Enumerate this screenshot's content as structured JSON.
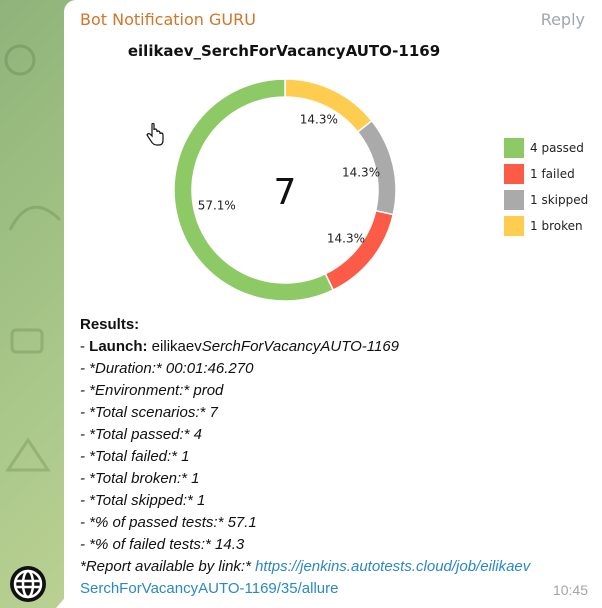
{
  "message": {
    "sender": "Bot Notification GURU",
    "reply_label": "Reply",
    "time": "10:45"
  },
  "colors": {
    "passed": "#8dc965",
    "failed": "#fc5b48",
    "skipped": "#aaaaaa",
    "broken": "#fecc4f",
    "sender": "#d0762a",
    "link": "#2a88c9"
  },
  "chart_data": {
    "type": "pie",
    "title": "eilikaev_SerchForVacancyAUTO-1169",
    "center_label": "7",
    "legend_position": "right",
    "slices": [
      {
        "name": "4 passed",
        "value": 4,
        "label": "57.1%",
        "color": "#8dc965"
      },
      {
        "name": "1 failed",
        "value": 1,
        "label": "14.3%",
        "color": "#fc5b48"
      },
      {
        "name": "1 skipped",
        "value": 1,
        "label": "14.3%",
        "color": "#aaaaaa"
      },
      {
        "name": "1 broken",
        "value": 1,
        "label": "14.3%",
        "color": "#fecc4f"
      }
    ]
  },
  "results": {
    "heading": "Results:",
    "launch_prefix": " - ",
    "launch_label": "Launch:",
    "launch_plain": " eilikaev",
    "launch_italic": "SerchForVacancyAUTO-1169",
    "lines": [
      " - *Duration:* 00:01:46.270",
      " - *Environment:* prod",
      " - *Total scenarios:* 7",
      " - *Total passed:* 4",
      " - *Total failed:* 1",
      " - *Total broken:* 1",
      "  - *Total skipped:* 1",
      " - *% of passed tests:* 57.1",
      " - *% of failed tests:* 14.3"
    ],
    "report_label": " *Report available by link:* ",
    "report_link_1": "https://jenkins.autotests.cloud/job/eilikaev",
    "report_link_2": "SerchForVacancyAUTO-1169/35/allure"
  }
}
